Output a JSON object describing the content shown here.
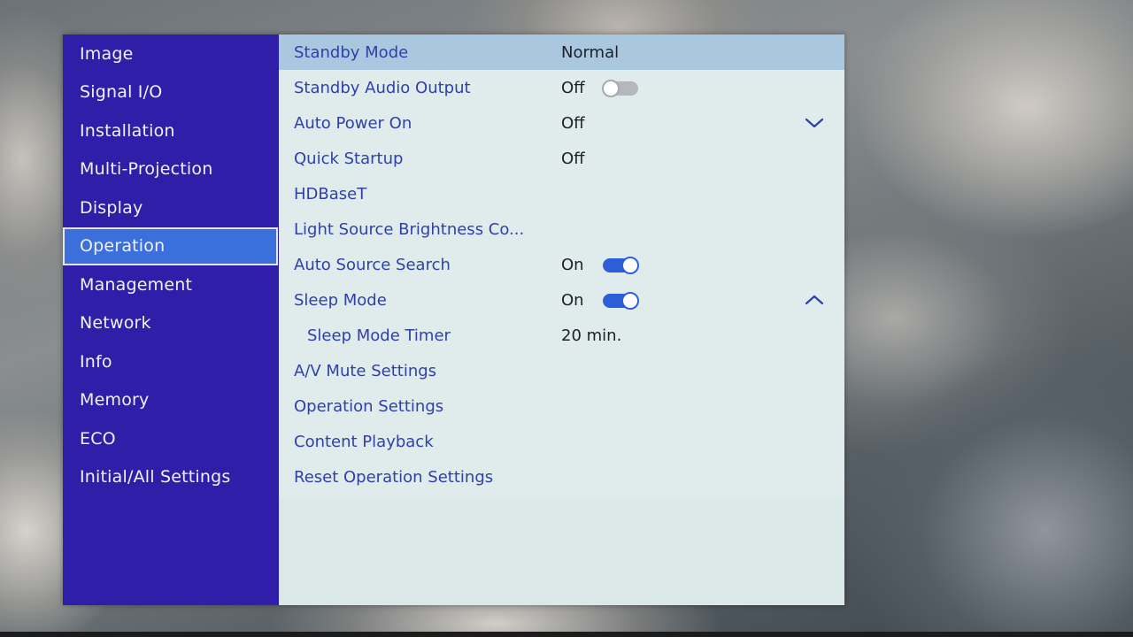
{
  "sidebar": {
    "items": [
      {
        "label": "Image"
      },
      {
        "label": "Signal I/O"
      },
      {
        "label": "Installation"
      },
      {
        "label": "Multi-Projection"
      },
      {
        "label": "Display"
      },
      {
        "label": "Operation"
      },
      {
        "label": "Management"
      },
      {
        "label": "Network"
      },
      {
        "label": "Info"
      },
      {
        "label": "Memory"
      },
      {
        "label": "ECO"
      },
      {
        "label": "Initial/All Settings"
      }
    ],
    "active": "Operation"
  },
  "settings": {
    "standby_mode": {
      "label": "Standby Mode",
      "value": "Normal"
    },
    "standby_audio_output": {
      "label": "Standby Audio Output",
      "value": "Off",
      "toggle": "off"
    },
    "auto_power_on": {
      "label": "Auto Power On",
      "value": "Off",
      "expander": "collapsed"
    },
    "quick_startup": {
      "label": "Quick Startup",
      "value": "Off"
    },
    "hdbaset": {
      "label": "HDBaseT"
    },
    "light_source_brightness": {
      "label": "Light Source Brightness Co..."
    },
    "auto_source_search": {
      "label": "Auto Source Search",
      "value": "On",
      "toggle": "on"
    },
    "sleep_mode": {
      "label": "Sleep Mode",
      "value": "On",
      "toggle": "on",
      "expander": "expanded"
    },
    "sleep_mode_timer": {
      "label": "Sleep Mode Timer",
      "value": "20 min."
    },
    "av_mute_settings": {
      "label": "A/V Mute Settings"
    },
    "operation_settings": {
      "label": "Operation Settings"
    },
    "content_playback": {
      "label": "Content Playback"
    },
    "reset_operation_settings": {
      "label": "Reset Operation Settings"
    }
  },
  "colors": {
    "sidebar_bg": "#2e1ea8",
    "sidebar_active_bg": "#3b6fdb",
    "content_bg": "#e0ecec",
    "selected_row_bg": "#a9c8e0",
    "label_text": "#2f40a8",
    "toggle_on": "#2f5fd8",
    "toggle_off": "#b4b8bc"
  },
  "icons": {
    "expand": "chevron-down-icon",
    "collapse": "chevron-up-icon"
  }
}
